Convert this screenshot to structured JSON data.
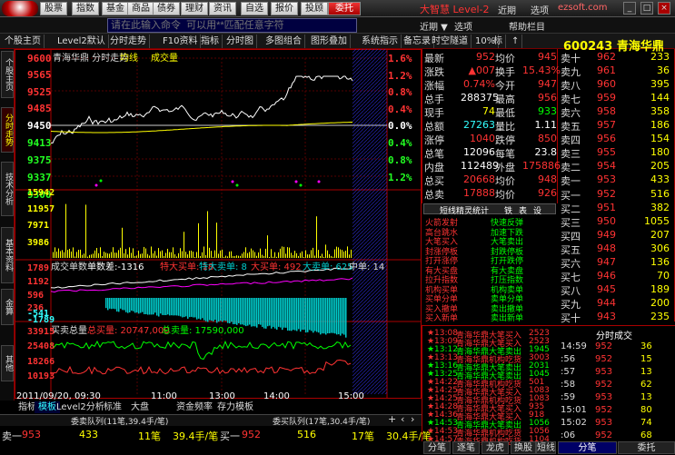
{
  "menu": {
    "buttons": [
      "股票",
      "指数",
      "基金",
      "商品",
      "债券",
      "理财",
      "资讯",
      "自选",
      "报价",
      "投顾",
      "委托"
    ],
    "active_index": 10,
    "app_title": "大智慧 Level-2",
    "right_items": [
      "近期",
      "选项",
      "帮助栏目"
    ],
    "site_logo": "ezsoft.com"
  },
  "search": {
    "placeholder": "请在此输入命令  可以用**匹配任意字符"
  },
  "toolbar": {
    "items": [
      "个股主页",
      "Level2默认",
      "分时走势",
      "F10资料",
      "指标",
      "分时图",
      "多图组合",
      "图形叠加",
      "系统指示",
      "备忘录",
      "时空隧道",
      "10%",
      "标",
      "↑"
    ],
    "stock_code": "600243",
    "stock_name": "青海华鼎"
  },
  "left_tabs": [
    "个股主页",
    "分时走势",
    "技术分析",
    "基本资料",
    "金算",
    "其他"
  ],
  "chart": {
    "header": {
      "title": "青海华鼎 分时走势",
      "line1": "均线",
      "line2": "成交量"
    },
    "price_labels": [
      "9600",
      "9565",
      "9525",
      "9485",
      "9450",
      "9413",
      "9375",
      "9337",
      "9300"
    ],
    "pct_labels": [
      "1.6%",
      "1.2%",
      "0.8%",
      "0.4%",
      "0.0%",
      "0.4%",
      "0.8%",
      "1.2%"
    ],
    "vol_labels": [
      "15942",
      "11957",
      "7971",
      "3986"
    ],
    "big_header": {
      "label": "成交单数",
      "count_label": "单数差:",
      "count": "-1316",
      "large_buy": "特大买单: 18",
      "large_sell": "特大卖单: 8",
      "big_buy": "大买单: 492",
      "big_sell": "大卖单: 625",
      "mid": "中单: 14"
    },
    "big_labels": [
      "1789",
      "1192",
      "596",
      "236",
      "-541",
      "-1789"
    ],
    "amount_header": {
      "label": "买卖总量",
      "total_buy": "总买量: 20747,000",
      "total_sell": "总卖量: 17590,000"
    },
    "amount_labels": [
      "33915",
      "25408",
      "18266",
      "10193"
    ],
    "time_labels": [
      "2011/09/20, 09:30",
      "11:00",
      "13:00",
      "14:00",
      "15:00"
    ]
  },
  "quote": [
    [
      "最新",
      "952",
      "均价",
      "945"
    ],
    [
      "涨跌",
      "▲007",
      "换手",
      "15.43%"
    ],
    [
      "涨幅",
      "0.74%",
      "今开",
      "947"
    ],
    [
      "总手",
      "288375",
      "最高",
      "956"
    ],
    [
      "现手",
      "74",
      "最低",
      "933"
    ],
    [
      "总额",
      "27263",
      "量比",
      "1.11"
    ],
    [
      "涨停",
      "1040",
      "跌停",
      "850"
    ],
    [
      "总笔",
      "12096",
      "每笔",
      "23.8"
    ],
    [
      "内盘",
      "112489",
      "外盘",
      "175886"
    ],
    [
      "总买",
      "20668",
      "均价",
      "948"
    ],
    [
      "总卖",
      "17888",
      "均价",
      "926"
    ]
  ],
  "orderbook": {
    "sell": [
      [
        "卖十",
        "962",
        "233"
      ],
      [
        "卖九",
        "961",
        "36"
      ],
      [
        "卖八",
        "960",
        "395"
      ],
      [
        "卖七",
        "959",
        "144"
      ],
      [
        "卖六",
        "958",
        "358"
      ],
      [
        "卖五",
        "957",
        "186"
      ],
      [
        "卖四",
        "956",
        "154"
      ],
      [
        "卖三",
        "955",
        "180"
      ],
      [
        "卖二",
        "954",
        "205"
      ],
      [
        "卖一",
        "953",
        "433"
      ]
    ],
    "buy": [
      [
        "买一",
        "952",
        "516"
      ],
      [
        "买二",
        "951",
        "382"
      ],
      [
        "买三",
        "950",
        "1055"
      ],
      [
        "买四",
        "949",
        "207"
      ],
      [
        "买五",
        "948",
        "306"
      ],
      [
        "买六",
        "947",
        "136"
      ],
      [
        "买七",
        "946",
        "70"
      ],
      [
        "买八",
        "945",
        "189"
      ],
      [
        "买九",
        "944",
        "200"
      ],
      [
        "买十",
        "943",
        "235"
      ]
    ]
  },
  "stats": {
    "title": "短线精灵统计",
    "tabs": [
      "铁",
      "表",
      "设"
    ],
    "rows": [
      [
        "火箭发射",
        "快速反弹"
      ],
      [
        "高台跳水",
        "加速下跌"
      ],
      [
        "大笔买入",
        "大笔卖出"
      ],
      [
        "封涨停板",
        "封跌停板"
      ],
      [
        "打开涨停",
        "打开跌停"
      ],
      [
        "有大买盘",
        "有大卖盘"
      ],
      [
        "拉升指数",
        "打压指数"
      ],
      [
        "机构买单",
        "机构卖单"
      ],
      [
        "买单分单",
        "卖单分单"
      ],
      [
        "买入撤单",
        "卖出撤单"
      ],
      [
        "买入新单",
        "卖出新单"
      ]
    ]
  },
  "trades": [
    [
      "13:08",
      "青海华鼎",
      "大笔买入",
      "2523"
    ],
    [
      "13:09",
      "青海华鼎",
      "大笔买入",
      "2523"
    ],
    [
      "13:12",
      "青海华鼎",
      "大笔卖出",
      "1945"
    ],
    [
      "13:13",
      "青海华鼎",
      "机构吃货",
      "3003"
    ],
    [
      "13:16",
      "青海华鼎",
      "大笔卖出",
      "2031"
    ],
    [
      "13:25",
      "青海华鼎",
      "大笔卖出",
      "1045"
    ],
    [
      "14:22",
      "青海华鼎",
      "机构吃货",
      "501"
    ],
    [
      "14:25",
      "青海华鼎",
      "大笔买入",
      "1083"
    ],
    [
      "14:25",
      "青海华鼎",
      "机构吃货",
      "1083"
    ],
    [
      "14:28",
      "青海华鼎",
      "大笔买入",
      "935"
    ],
    [
      "14:36",
      "青海华鼎",
      "大笔买入",
      "918"
    ],
    [
      "14:53",
      "青海华鼎",
      "大笔卖出",
      "1056"
    ],
    [
      "14:53",
      "青海华鼎",
      "机构吃货",
      "1056"
    ],
    [
      "14:57",
      "青海华鼎",
      "机构吃货",
      "1104"
    ]
  ],
  "ticks": {
    "title": "分时成交",
    "rows": [
      [
        "14:59",
        "952",
        "36"
      ],
      [
        ":56",
        "952",
        "15"
      ],
      [
        ":57",
        "953",
        "13"
      ],
      [
        ":58",
        "952",
        "62"
      ],
      [
        ":59",
        "953",
        "13"
      ],
      [
        "15:01",
        "952",
        "80"
      ],
      [
        "15:02",
        "953",
        "74"
      ],
      [
        ":06",
        "952",
        "68"
      ]
    ]
  },
  "bottom": {
    "tabs": [
      "指标",
      "模板",
      "Level2分析",
      "标准",
      "大盘",
      "资金频率",
      "存力模板"
    ],
    "queue_sell": "委卖队列(11笔,39.4手/笔)",
    "queue_buy": "委买队列(17笔,30.4手/笔)",
    "sell1": [
      "卖一",
      "953",
      "433",
      "11笔",
      "39.4手/笔"
    ],
    "buy1": [
      "买一",
      "952",
      "516",
      "17笔",
      "30.4手/笔"
    ]
  },
  "right_bottom_tabs": [
    "分笔",
    "逐笔",
    "龙虎",
    "换股",
    "短线",
    "分笔",
    "委托"
  ],
  "colors": {
    "up": "#ff3333",
    "down": "#22ff22",
    "accent": "#ffff00",
    "border": "#aa0000"
  }
}
